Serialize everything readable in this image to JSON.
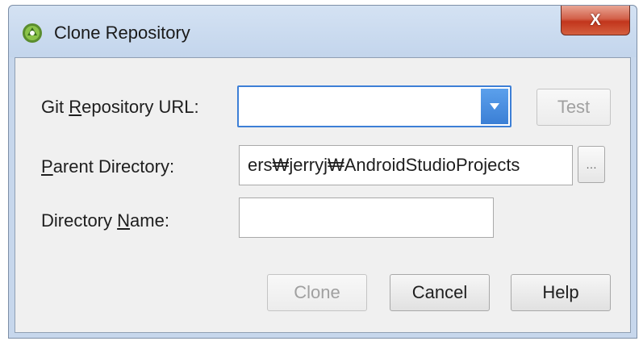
{
  "window": {
    "title": "Clone Repository",
    "close_label": "X"
  },
  "form": {
    "git_url": {
      "label_pre": "Git ",
      "label_mnemonic": "R",
      "label_post": "epository URL:",
      "value": ""
    },
    "test_button": "Test",
    "parent_dir": {
      "label_mnemonic": "P",
      "label_post": "arent Directory:",
      "value": "ers₩jerryj₩AndroidStudioProjects"
    },
    "browse_button": "…",
    "dir_name": {
      "label_pre": "Directory ",
      "label_mnemonic": "N",
      "label_post": "ame:",
      "value": ""
    }
  },
  "buttons": {
    "clone": "Clone",
    "cancel": "Cancel",
    "help": "Help"
  },
  "colors": {
    "focus_border": "#3d7fd6",
    "close_red": "#c2351c",
    "android_green": "#8bc34a"
  },
  "icons": {
    "app": "android-studio-icon",
    "dropdown": "chevron-down-icon"
  }
}
